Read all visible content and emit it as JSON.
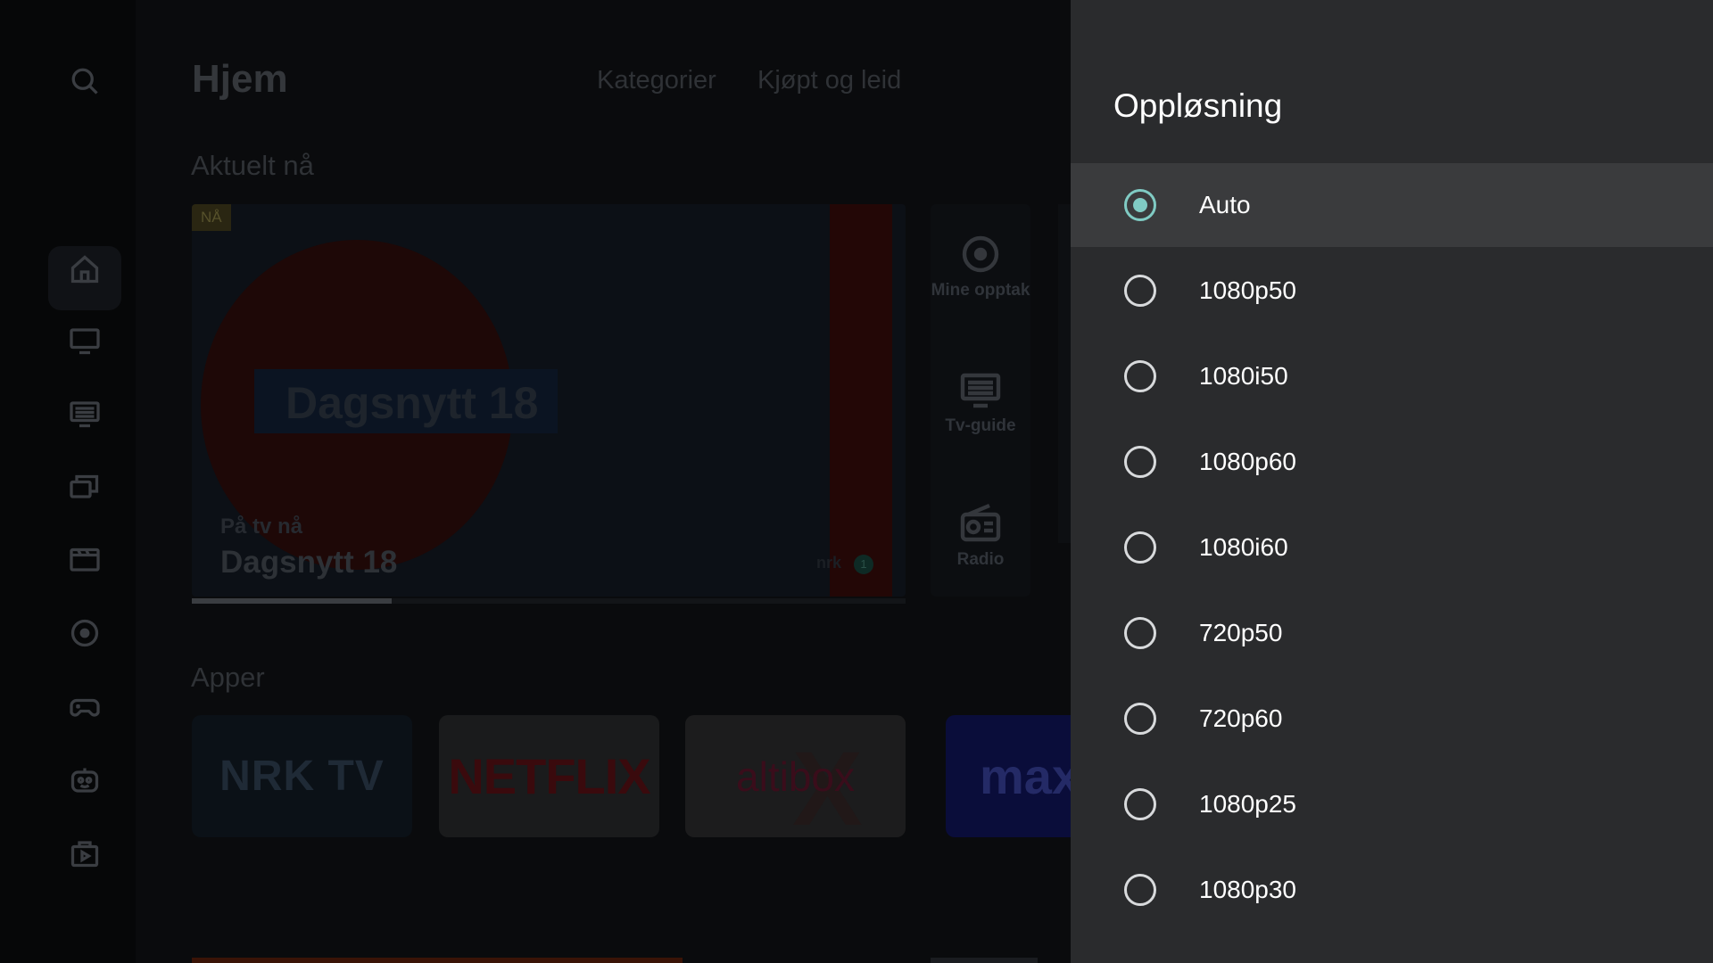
{
  "home": {
    "title": "Hjem",
    "nav": {
      "kategorier": "Kategorier",
      "kjopt": "Kjøpt og leid"
    },
    "sections": {
      "aktuelt": "Aktuelt nå",
      "apper": "Apper"
    },
    "hero": {
      "badge": "NÅ",
      "show_graphic": "Dagsnytt 18",
      "subtitle": "På tv nå",
      "program": "Dagsnytt 18",
      "channel": "nrk",
      "channel_number": "1",
      "progress_percent": 28
    },
    "quick_links": [
      {
        "label": "Mine opptak",
        "icon": "record-icon"
      },
      {
        "label": "Tv-guide",
        "icon": "tv-guide-icon"
      },
      {
        "label": "Radio",
        "icon": "radio-icon"
      }
    ],
    "apps": {
      "nrk": "NRK TV",
      "netflix": "NETFLIX",
      "altibox": "altibox",
      "altibox_mark": "X",
      "max": "max"
    },
    "rail_icons": [
      "search-icon",
      "home-icon",
      "tv-icon",
      "tv-guide-icon",
      "library-icon",
      "store-icon",
      "record-icon",
      "gamepad-icon",
      "kids-icon",
      "apps-icon"
    ]
  },
  "panel": {
    "title": "Oppløsning",
    "selected": "Auto",
    "accent_color": "#80cbc4",
    "options": [
      "Auto",
      "1080p50",
      "1080i50",
      "1080p60",
      "1080i60",
      "720p50",
      "720p60",
      "1080p25",
      "1080p30"
    ]
  }
}
